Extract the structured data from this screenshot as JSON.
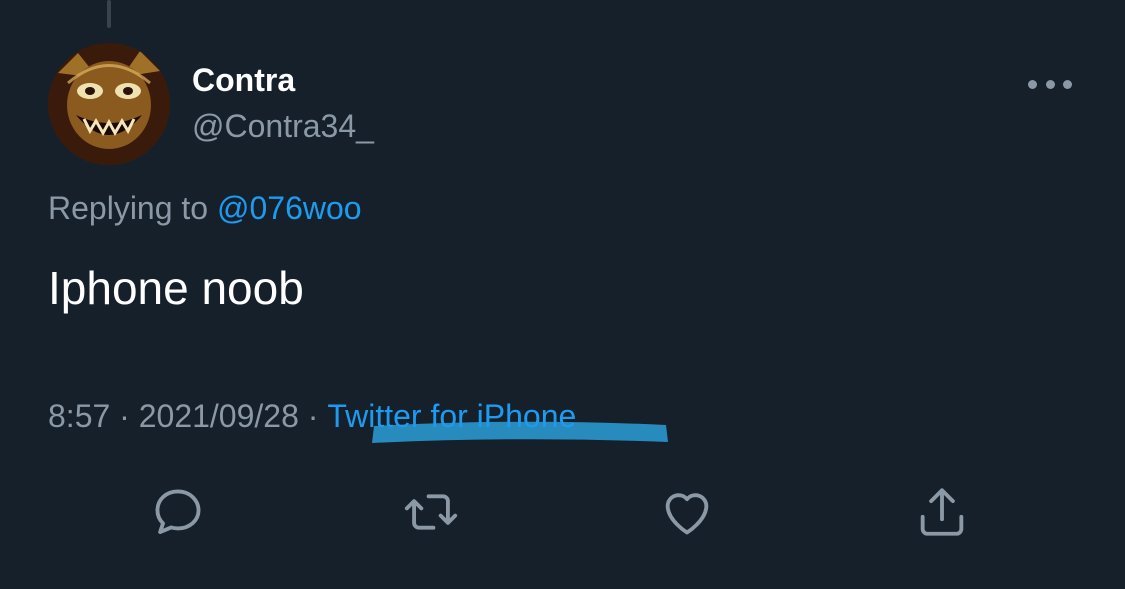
{
  "tweet": {
    "author": {
      "display_name": "Contra",
      "handle": "@Contra34_",
      "avatar_icon": "avatar-demon-face-icon"
    },
    "replying_prefix": "Replying to",
    "replying_to": "@076woo",
    "text": "Iphone noob",
    "time": "8:57",
    "separator": "·",
    "date": "2021/09/28",
    "source": "Twitter for iPhone"
  },
  "actions": [
    {
      "name": "reply",
      "icon": "reply-icon"
    },
    {
      "name": "retweet",
      "icon": "retweet-icon"
    },
    {
      "name": "like",
      "icon": "heart-icon"
    },
    {
      "name": "share",
      "icon": "share-icon"
    }
  ],
  "colors": {
    "background": "#15202b",
    "text_primary": "#ffffff",
    "text_secondary": "#8b98a5",
    "accent": "#1d9bf0",
    "highlight_marker": "#2a9fd8"
  }
}
